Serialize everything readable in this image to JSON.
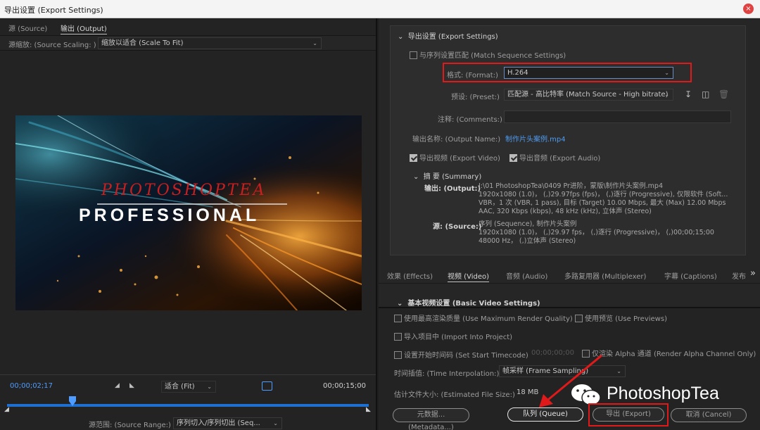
{
  "window": {
    "title": "导出设置 (Export Settings)",
    "close_label": "×"
  },
  "left": {
    "tabs": [
      "源 (Source)",
      "输出 (Output)"
    ],
    "source_scaling_label": "源缩放: (Source Scaling: )",
    "source_scaling_value": "缩放以适合 (Scale To Fit)",
    "preview": {
      "line1": "PHOTOSHOPTEA",
      "line2": "PROFESSIONAL"
    },
    "timeline": {
      "current_tc": "00;00;02;17",
      "end_tc": "00;00;15;00",
      "fit_value": "适合 (Fit)",
      "playhead_fraction": 0.18,
      "source_range_label": "源范围: (Source Range:)",
      "source_range_value": "序列切入/序列切出 (Seq..."
    }
  },
  "right": {
    "export_settings": {
      "header": "导出设置 (Export Settings)",
      "match_sequence": "与序列设置匹配 (Match Sequence Settings)",
      "format_label": "格式: (Format:)",
      "format_value": "H.264",
      "preset_label": "预设: (Preset:)",
      "preset_value": "匹配源 - 高比特率 (Match Source - High bitrate)",
      "comments_label": "注释: (Comments:)",
      "comments_value": "",
      "output_name_label": "输出名称: (Output Name:)",
      "output_name_value": "制作片头案例.mp4",
      "export_video": "导出视频 (Export Video)",
      "export_audio": "导出音频 (Export Audio)",
      "summary_header": "摘 要 (Summary)",
      "output_label": "输出: (Output:)",
      "output_lines": [
        "I:\\01 PhotoshopTea\\0409 Pr进阶，蒙版\\制作片头案例.mp4",
        "1920x1080 (1.0)，  (,)29.97fps (fps)，  (,)逐行 (Progressive), 仅限软件 (Soft...",
        "VBR，1 次 (VBR, 1 pass), 目标 (Target) 10.00 Mbps, 最大 (Max) 12.00 Mbps",
        "AAC, 320 Kbps (kbps), 48  kHz (kHz), 立体声 (Stereo)"
      ],
      "source_label": "源: (Source:)",
      "source_lines": [
        "序列 (Sequence), 制作片头案例",
        "1920x1080 (1.0)，  (,)29.97 fps，  (,)逐行 (Progressive)，  (,)00;00;15;00",
        "48000 Hz，  (,)立体声 (Stereo)"
      ]
    },
    "tabs": [
      "效果 (Effects)",
      "视频 (Video)",
      "音频 (Audio)",
      "多路复用器 (Multiplexer)",
      "字幕 (Captions)",
      "发布"
    ],
    "tabs_more": "»",
    "basic_video_header": "基本视频设置 (Basic Video Settings)",
    "options": {
      "max_render_quality": "使用最高渲染质量 (Use Maximum Render Quality)",
      "use_previews": "使用预览 (Use Previews)",
      "import_into_project": "导入项目中 (Import Into Project)",
      "set_start_timecode": "设置开始时间码 (Set Start Timecode)",
      "start_timecode_value": "00;00;00;00",
      "render_alpha": "仅渲染 Alpha 通道 (Render Alpha Channel Only)",
      "time_interp_label": "时间插值: (Time Interpolation:)",
      "time_interp_value": "帧采样 (Frame Sampling)",
      "file_size_label": "估计文件大小: (Estimated File Size:)",
      "file_size_value": "18 MB"
    },
    "buttons": {
      "metadata": "元数据... (Metadata...)",
      "queue": "队列 (Queue)",
      "export": "导出 (Export)",
      "cancel": "取消 (Cancel)"
    },
    "watermark": "PhotoshopTea"
  },
  "colors": {
    "accent_blue": "#4e9cff",
    "highlight_red": "#e01a1a"
  }
}
